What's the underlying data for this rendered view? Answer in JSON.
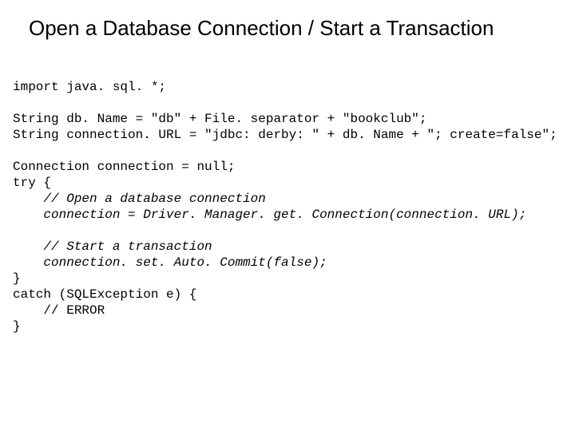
{
  "title": "Open a Database Connection / Start a Transaction",
  "code": {
    "l1": "import java. sql. *;",
    "l2": "String db. Name = \"db\" + File. separator + \"bookclub\";",
    "l3": "String connection. URL = \"jdbc: derby: \" + db. Name + \"; create=false\";",
    "l4": "Connection connection = null;",
    "l5": "try {",
    "l6a": "    ",
    "l6b": "// Open a database connection",
    "l7a": "    ",
    "l7b": "connection = Driver. Manager. get. Connection(connection. URL);",
    "l8a": "    ",
    "l8b": "// Start a transaction",
    "l9a": "    ",
    "l9b": "connection. set. Auto. Commit(false);",
    "l10": "}",
    "l11": "catch (SQLException e) {",
    "l12": "    // ERROR",
    "l13": "}"
  }
}
